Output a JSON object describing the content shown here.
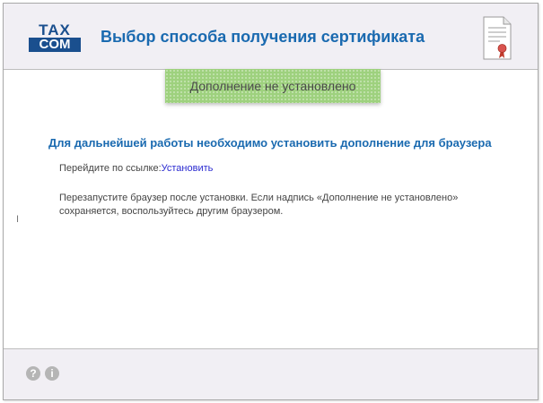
{
  "header": {
    "logo_top": "TAX",
    "logo_bottom": "COM",
    "title": "Выбор способа получения сертификата",
    "cert_icon": "certificate-document-icon"
  },
  "status": {
    "label": "Дополнение не установлено",
    "color": "#9ed17e"
  },
  "main": {
    "heading": "Для дальнейшей работы необходимо установить дополнение для браузера",
    "goto_prefix": "Перейдите по ссылке:",
    "install_link": "Установить",
    "restart_line1": "Перезапустите браузер после установки. Если надпись «Дополнение не установлено»",
    "restart_line2": "сохраняется, воспользуйтесь другим браузером."
  },
  "footer": {
    "help_icon": "?",
    "info_icon": "i"
  },
  "colors": {
    "accent": "#1a6ab0",
    "brand": "#1a4f8e",
    "link": "#2a2ad0",
    "panel": "#f1eff4"
  }
}
